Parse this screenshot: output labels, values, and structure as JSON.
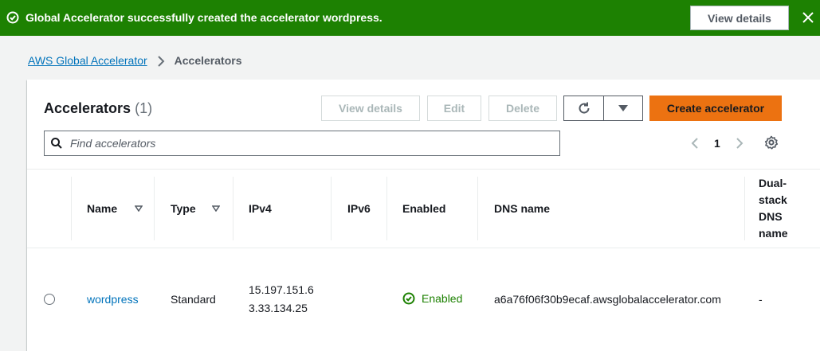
{
  "flash": {
    "message": "Global Accelerator successfully created the accelerator wordpress.",
    "view_details_label": "View details",
    "icon": "check-circle-icon",
    "close_icon": "close-icon",
    "color": "#1d8102"
  },
  "breadcrumb": {
    "items": [
      {
        "label": "AWS Global Accelerator"
      },
      {
        "label": "Accelerators"
      }
    ]
  },
  "accelerators": {
    "title": "Accelerators",
    "count": "(1)",
    "buttons": {
      "view_details": "View details",
      "edit": "Edit",
      "delete": "Delete",
      "create": "Create accelerator"
    },
    "search": {
      "placeholder": "Find accelerators",
      "value": ""
    },
    "pagination": {
      "current_page": "1"
    },
    "columns": {
      "name": "Name",
      "type": "Type",
      "ipv4": "IPv4",
      "ipv6": "IPv6",
      "enabled": "Enabled",
      "dns_name": "DNS name",
      "dual_stack": [
        "Dual-",
        "stack",
        "DNS",
        "name"
      ]
    },
    "rows": [
      {
        "name": "wordpress",
        "type": "Standard",
        "ipv4": [
          "15.197.151.6",
          "3.33.134.25"
        ],
        "ipv6": "",
        "enabled": "Enabled",
        "dns_name": "a6a76f06f30b9ecaf.awsglobalaccelerator.com",
        "dual_stack_dns": "-"
      }
    ],
    "colors": {
      "primary": "#ec7211",
      "link": "#0073bb",
      "success": "#1d8102"
    }
  }
}
